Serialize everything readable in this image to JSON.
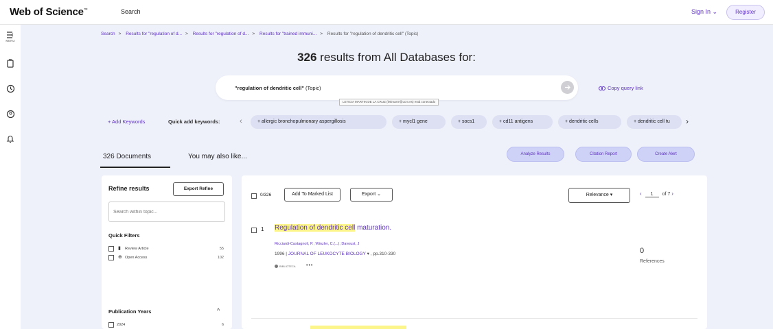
{
  "header": {
    "logo_text": "Web of Science",
    "logo_tm": "™",
    "search_link": "Search",
    "signin_label": "Sign In ⌄",
    "register_label": "Register"
  },
  "rail": {
    "menu_label": "MENU"
  },
  "breadcrumb": {
    "items": [
      "Search",
      "Results for \"regulation of d...",
      "Results for \"regulation of d...",
      "Results for \"trained immuni...",
      "Results for \"regulation of dendritic cell\" (Topic)"
    ],
    "separator": ">"
  },
  "results": {
    "count": "326",
    "heading_rest": "results from All Databases for:"
  },
  "query": {
    "term": "\"regulation of dendritic cell\"",
    "field": "(Topic)",
    "tooltip": "LETICIA MARTIN DE LA CRUZ (letimart7@ucm.es) está conectado",
    "copy_link_label": "Copy query link"
  },
  "keywords": {
    "add_label": "+ Add Keywords",
    "quick_label": "Quick add keywords:",
    "chips": [
      "+ allergic bronchopulmonary aspergillosis",
      "+ mycl1 gene",
      "+ socs1",
      "+ cd11 antigens",
      "+ dendritic cells",
      "+ dendritic cell tu"
    ]
  },
  "tabs": {
    "documents": "326 Documents",
    "also_like": "You may also like..."
  },
  "actions": {
    "analyze": "Analyze Results",
    "citation": "Citation Report",
    "alert": "Create Alert"
  },
  "refine": {
    "title": "Refine results",
    "export_label": "Export Refine",
    "search_placeholder": "Search within topic...",
    "quick_filters_title": "Quick Filters",
    "quick_filters": [
      {
        "label": "Review Article",
        "count": "55",
        "icon": "review-article-icon"
      },
      {
        "label": "Open Access",
        "count": "102",
        "icon": "open-access-icon"
      }
    ],
    "pub_years_title": "Publication Years",
    "pub_years": [
      {
        "year": "2024",
        "count": "6"
      },
      {
        "year": "2023",
        "count": "8"
      }
    ]
  },
  "toolbar": {
    "selected_count": "0/326",
    "add_marked": "Add To Marked List",
    "export": "Export ⌄",
    "sort": "Relevance ▾",
    "page_prev": "‹",
    "page_current": "1",
    "page_of": "of 7",
    "page_next": "›"
  },
  "record": {
    "number": "1",
    "title_highlight": "Regulation of dendritic cell",
    "title_rest": " maturation.",
    "authors": "Ricciardi-Castagnoli, P.; Winzler, C.(...); Davoust, J",
    "year": "1996",
    "journal": "JOURNAL OF LEUKOCYTE BIOLOGY",
    "pages": ", pp.310-330",
    "badge": "BIBLIOTECA",
    "more": "•••",
    "references_count": "0",
    "references_label": "References"
  }
}
